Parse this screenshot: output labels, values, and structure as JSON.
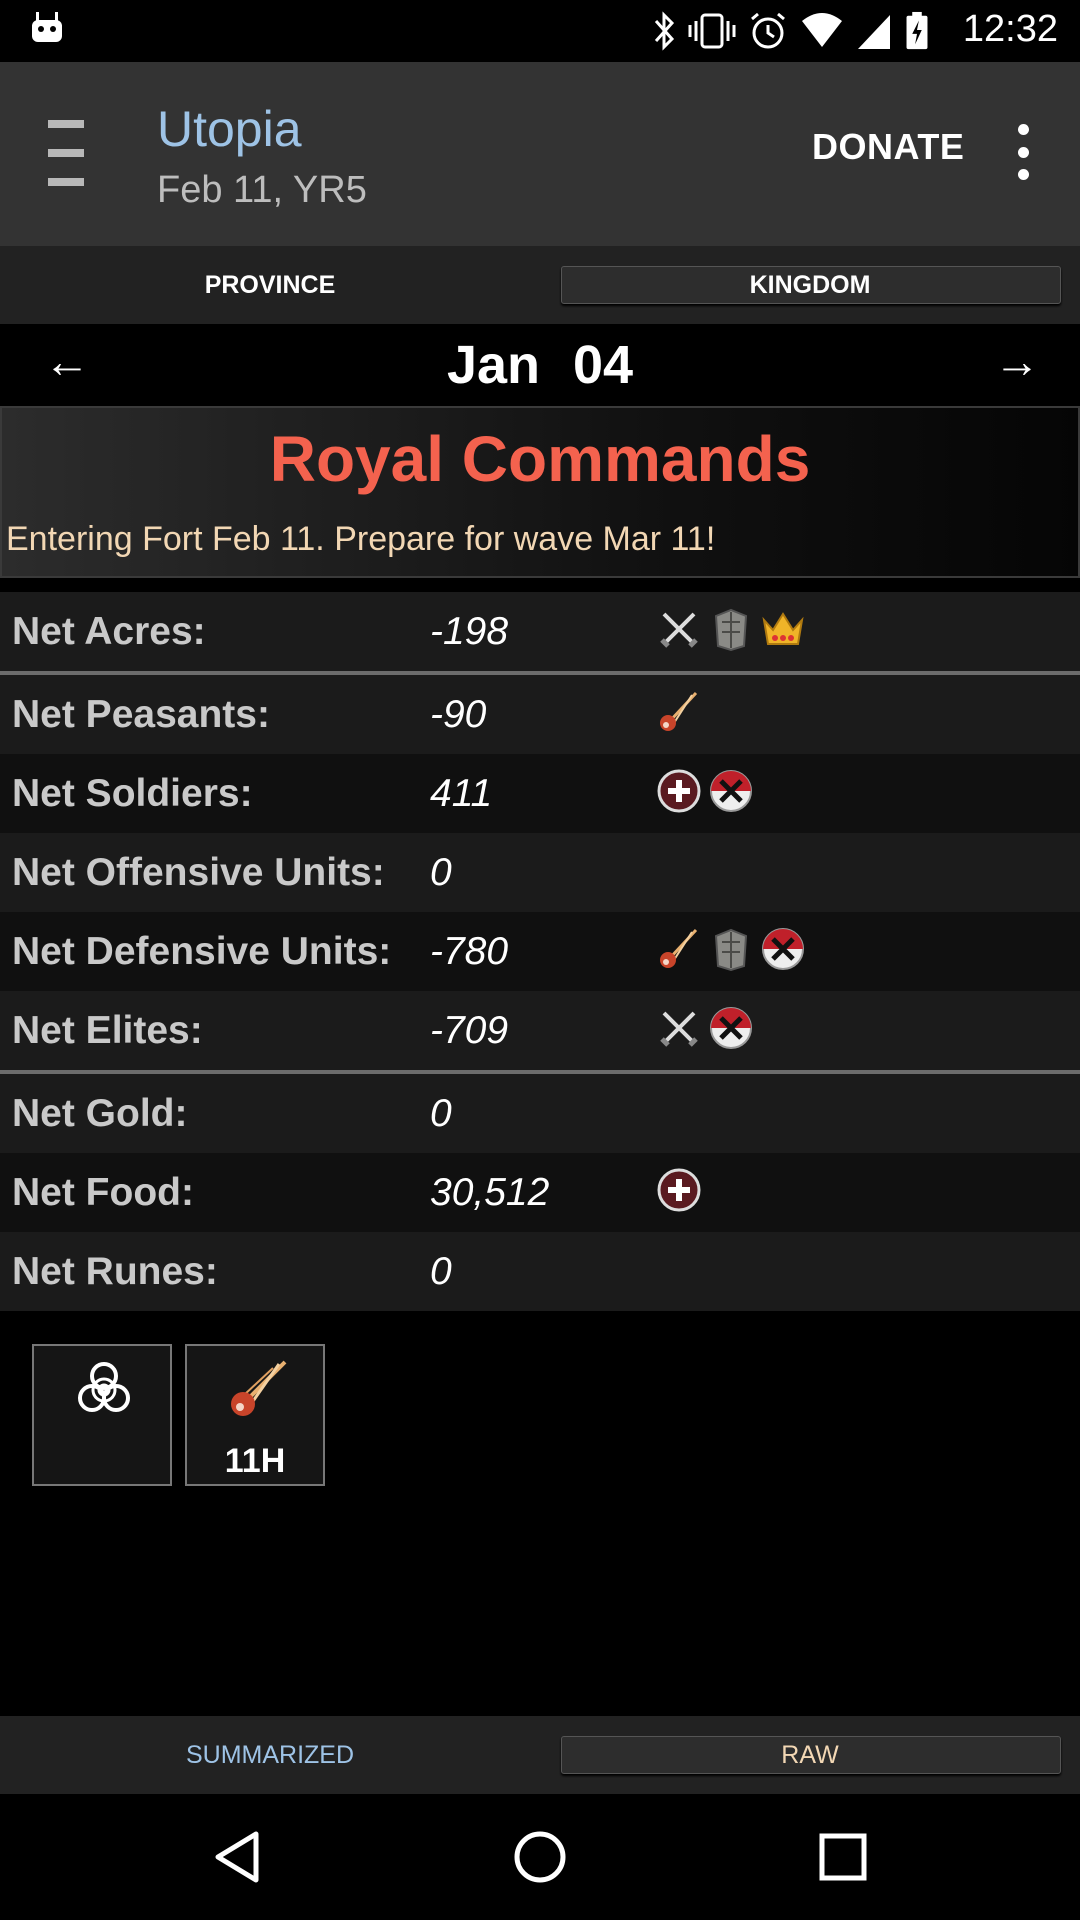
{
  "status_bar": {
    "time": "12:32"
  },
  "app_bar": {
    "title": "Utopia",
    "subtitle": "Feb 11, YR5",
    "donate_label": "DONATE"
  },
  "top_tabs": [
    {
      "label": "PROVINCE",
      "active": false,
      "color": "#ffffff"
    },
    {
      "label": "KINGDOM",
      "active": true,
      "color": "#ffffff"
    }
  ],
  "date_nav": {
    "prev": "←",
    "date": "Jan 04",
    "next": "→"
  },
  "royal_commands": {
    "title": "Royal Commands",
    "message": "Entering Fort Feb 11. Prepare for wave Mar 11!",
    "title_color": "#f4624e"
  },
  "stats": [
    {
      "label": "Net Acres:",
      "value": "-198",
      "icons": [
        "crossed-swords-icon",
        "armor-icon",
        "crown-icon"
      ]
    },
    {
      "label": "Net Peasants:",
      "value": "-90",
      "icons": [
        "meteor-icon"
      ]
    },
    {
      "label": "Net Soldiers:",
      "value": "411",
      "icons": [
        "medic-cross-icon",
        "crossed-shield-icon"
      ]
    },
    {
      "label": "Net Offensive Units:",
      "value": "0",
      "icons": []
    },
    {
      "label": "Net Defensive Units:",
      "value": "-780",
      "icons": [
        "meteor-icon",
        "armor-icon",
        "crossed-shield-icon"
      ]
    },
    {
      "label": "Net Elites:",
      "value": "-709",
      "icons": [
        "crossed-swords-icon",
        "crossed-shield-icon"
      ]
    },
    {
      "label": "Net Gold:",
      "value": "0",
      "icons": []
    },
    {
      "label": "Net Food:",
      "value": "30,512",
      "icons": [
        "medic-cross-icon"
      ]
    },
    {
      "label": "Net Runes:",
      "value": "0",
      "icons": []
    }
  ],
  "effects": [
    {
      "icon": "biohazard-icon",
      "label": ""
    },
    {
      "icon": "meteor-icon",
      "label": "11H"
    }
  ],
  "bottom_tabs": [
    {
      "label": "SUMMARIZED",
      "active": false,
      "color": "#9ec3e6"
    },
    {
      "label": "RAW",
      "active": true,
      "color": "#f2d7b4"
    }
  ]
}
